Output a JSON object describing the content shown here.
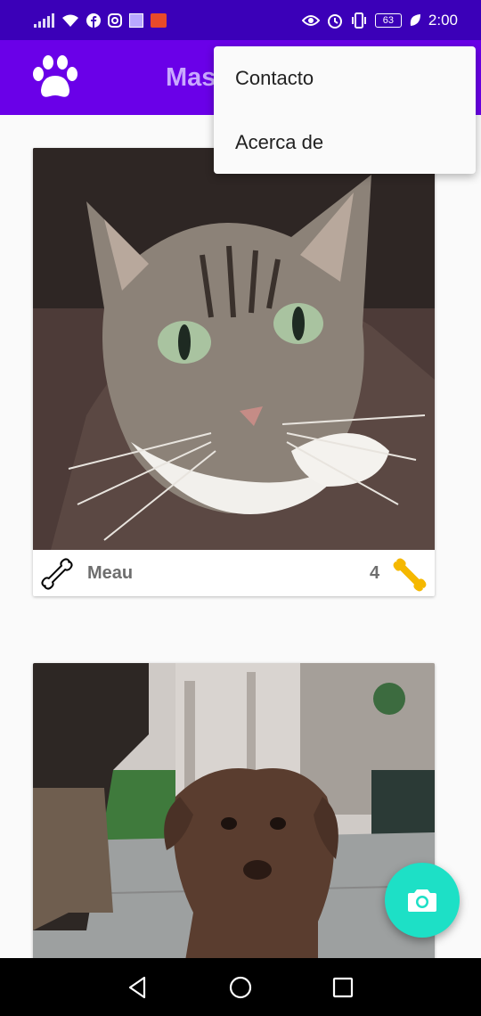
{
  "status_bar": {
    "battery_level": "63",
    "time": "2:00",
    "icons": [
      "signal-icon",
      "wifi-icon",
      "facebook-icon",
      "instagram-icon",
      "app-square-icon",
      "mail-icon",
      "eye-icon",
      "alarm-icon",
      "vibrate-icon",
      "battery-icon",
      "leaf-icon"
    ]
  },
  "app_bar": {
    "title": "Mas",
    "logo_icon": "paw-icon"
  },
  "menu": {
    "items": [
      {
        "label": "Contacto"
      },
      {
        "label": "Acerca de"
      }
    ]
  },
  "pets": [
    {
      "name": "Meau",
      "rating": "4"
    }
  ],
  "fab": {
    "icon": "camera-icon"
  },
  "nav": {
    "icons": [
      "back-icon",
      "home-icon",
      "recents-icon"
    ]
  },
  "colors": {
    "status_bar": "#3b00b8",
    "app_bar": "#6a00e8",
    "fab": "#1de0c6",
    "bone_accent": "#f5b800"
  }
}
